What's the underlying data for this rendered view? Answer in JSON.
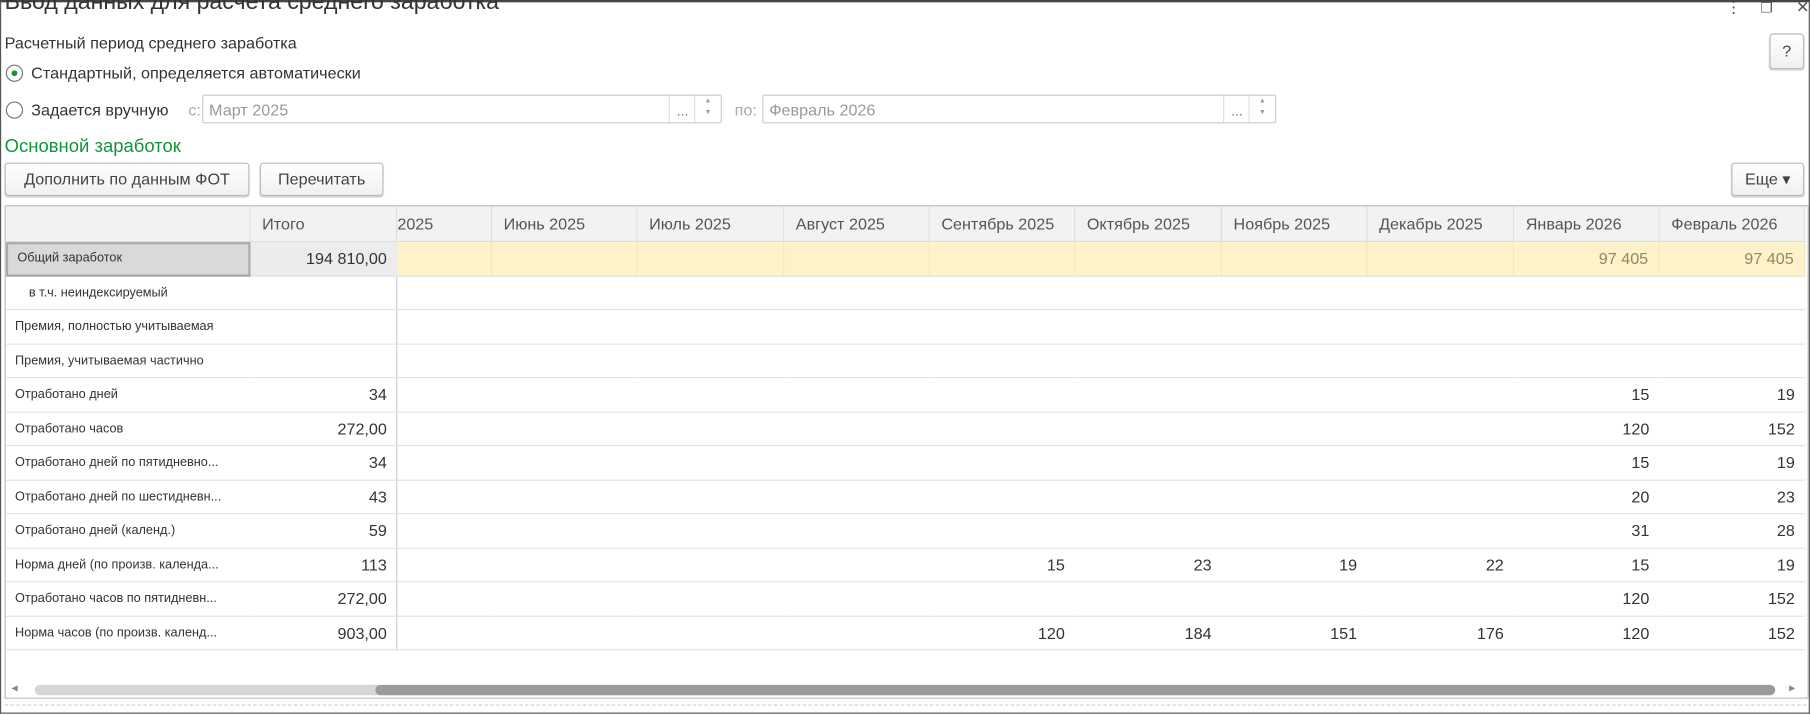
{
  "window": {
    "title": "Ввод данных для расчета среднего заработка",
    "more_icon": "vertical-dots-icon",
    "restore_icon": "restore-icon",
    "close_icon": "close-icon",
    "close_glyph": "✕",
    "more_glyph": "⋮",
    "restore_glyph": "❐"
  },
  "help": {
    "label": "?"
  },
  "period": {
    "heading": "Расчетный период среднего заработка",
    "option_auto": "Стандартный, определяется автоматически",
    "option_manual": "Задается вручную",
    "selected": "auto",
    "from_label": "с:",
    "from_value": "Март 2025",
    "to_label": "по:",
    "to_value": "Февраль 2026",
    "dots": "..."
  },
  "section": {
    "title": "Основной заработок"
  },
  "toolbar": {
    "fill_fot": "Дополнить по данным ФОТ",
    "recalc": "Перечитать",
    "more": "Еще ▾"
  },
  "colors": {
    "accent": "#12943b",
    "highlight_row": "#fdf2c8"
  },
  "table": {
    "columns": [
      "",
      "Итого",
      "2025",
      "Июнь 2025",
      "Июль 2025",
      "Август 2025",
      "Сентябрь 2025",
      "Октябрь 2025",
      "Ноябрь 2025",
      "Декабрь 2025",
      "Январь 2026",
      "Февраль 2026"
    ],
    "rows": [
      {
        "label": "Общий заработок",
        "total": "194 810,00",
        "cells": [
          "",
          "",
          "",
          "",
          "",
          "",
          "",
          "",
          "97 405",
          "97 405"
        ]
      },
      {
        "label": "в т.ч. неиндексируемый",
        "total": "",
        "cells": [
          "",
          "",
          "",
          "",
          "",
          "",
          "",
          "",
          "",
          ""
        ],
        "indent": true
      },
      {
        "label": "Премия, полностью учитываемая",
        "total": "",
        "cells": [
          "",
          "",
          "",
          "",
          "",
          "",
          "",
          "",
          "",
          ""
        ]
      },
      {
        "label": "Премия, учитываемая частично",
        "total": "",
        "cells": [
          "",
          "",
          "",
          "",
          "",
          "",
          "",
          "",
          "",
          ""
        ]
      },
      {
        "label": "Отработано дней",
        "total": "34",
        "cells": [
          "",
          "",
          "",
          "",
          "",
          "",
          "",
          "",
          "15",
          "19"
        ]
      },
      {
        "label": "Отработано часов",
        "total": "272,00",
        "cells": [
          "",
          "",
          "",
          "",
          "",
          "",
          "",
          "",
          "120",
          "152"
        ]
      },
      {
        "label": "Отработано дней по пятидневно...",
        "total": "34",
        "cells": [
          "",
          "",
          "",
          "",
          "",
          "",
          "",
          "",
          "15",
          "19"
        ]
      },
      {
        "label": "Отработано дней по шестидневн...",
        "total": "43",
        "cells": [
          "",
          "",
          "",
          "",
          "",
          "",
          "",
          "",
          "20",
          "23"
        ]
      },
      {
        "label": "Отработано дней (календ.)",
        "total": "59",
        "cells": [
          "",
          "",
          "",
          "",
          "",
          "",
          "",
          "",
          "31",
          "28"
        ]
      },
      {
        "label": "Норма дней (по произв. календа...",
        "total": "113",
        "cells": [
          "",
          "",
          "",
          "",
          "15",
          "23",
          "19",
          "22",
          "15",
          "19"
        ]
      },
      {
        "label": "Отработано часов по пятидневн...",
        "total": "272,00",
        "cells": [
          "",
          "",
          "",
          "",
          "",
          "",
          "",
          "",
          "120",
          "152"
        ]
      },
      {
        "label": "Норма часов (по произв. календ...",
        "total": "903,00",
        "cells": [
          "",
          "",
          "",
          "",
          "120",
          "184",
          "151",
          "176",
          "120",
          "152"
        ]
      }
    ]
  }
}
